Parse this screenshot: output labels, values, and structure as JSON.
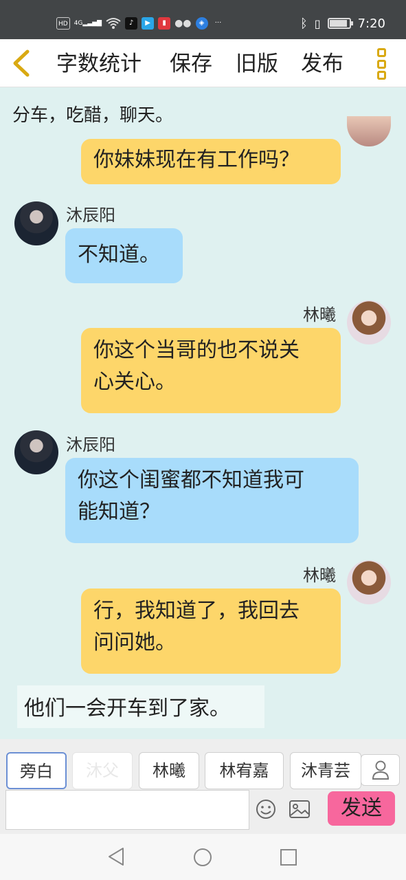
{
  "status_bar": {
    "left_icons": [
      "hd-icon",
      "signal-icon",
      "wifi-icon",
      "tiktok-icon",
      "video-app-icon",
      "reader-app-icon",
      "wechat-icon",
      "browser-icon"
    ],
    "hd_label": "HD",
    "net_label": "4G",
    "more_label": "···",
    "time": "7:20",
    "battery_level": 0.9
  },
  "toolbar": {
    "back": "back-chevron-icon",
    "items": [
      "字数统计",
      "保存",
      "旧版",
      "发布"
    ],
    "accent_color": "#d9a912"
  },
  "chat": {
    "scene_note": "分车，吃醋，聊天。",
    "messages": [
      {
        "side": "right",
        "speaker": "",
        "text_lines": [
          "你妹妹现在有工作吗？"
        ]
      },
      {
        "side": "left",
        "speaker": "沐辰阳",
        "text_lines": [
          "不知道。"
        ]
      },
      {
        "side": "right",
        "speaker": "林曦",
        "text_lines": [
          "你这个当哥的也不说关",
          "心关心。"
        ]
      },
      {
        "side": "left",
        "speaker": "沐辰阳",
        "text_lines": [
          "你这个闺蜜都不知道我可",
          "能知道？"
        ]
      },
      {
        "side": "right",
        "speaker": "林曦",
        "text_lines": [
          "行，我知道了，我回去",
          "问问她。"
        ]
      }
    ],
    "narration": "他们一会开车到了家。"
  },
  "input": {
    "roles": [
      "旁白",
      "沐父",
      "林曦",
      "林宥嘉",
      "沐青芸"
    ],
    "placeholder": "",
    "send_label": "发送",
    "send_color": "#f7679d"
  }
}
